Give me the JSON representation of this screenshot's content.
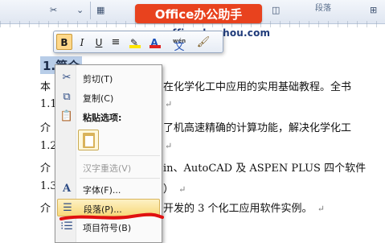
{
  "watermark": {
    "banner": "Office办公助手",
    "url": "www.officezhushou.com"
  },
  "ribbon": {
    "group_label": "段落",
    "icons": [
      "scissors-icon",
      "table-icon",
      "align-icon"
    ]
  },
  "document": {
    "heading": "1.简介",
    "lines": [
      {
        "left": "本",
        "right": "在化学化工中应用的实用基础教程。全书"
      },
      {
        "left": "1.1",
        "right": ""
      },
      {
        "left": "介",
        "right": "了机高速精确的计算功能，解决化学化工"
      },
      {
        "left": "1.2",
        "right": ""
      },
      {
        "left": "介",
        "right": "in、AutoCAD 及 ASPEN PLUS 四个软件"
      },
      {
        "left": "1.3",
        "right": "）"
      },
      {
        "left": "介",
        "right": "开发的 3 个化工应用软件实例。"
      }
    ],
    "para_mark": "↵"
  },
  "mini_toolbar": {
    "bold": "B",
    "italic": "I",
    "underline": "U",
    "align": "≡",
    "highlight": "✎",
    "font_color": "A",
    "phonetic_top": "wén",
    "phonetic_char": "文",
    "format_painter": "🖌"
  },
  "context_menu": {
    "items": [
      {
        "label": "剪切(T)",
        "icon": "scissors-icon",
        "enabled": true
      },
      {
        "label": "复制(C)",
        "icon": "copy-icon",
        "enabled": true
      },
      {
        "label": "粘贴选项:",
        "icon": "paste-icon",
        "enabled": true
      },
      {
        "label": "汉字重选(V)",
        "icon": "",
        "enabled": false
      },
      {
        "label": "字体(F)...",
        "icon": "font-icon",
        "enabled": true
      },
      {
        "label": "段落(P)...",
        "icon": "paragraph-icon",
        "enabled": true,
        "highlighted": true
      },
      {
        "label": "项目符号(B)",
        "icon": "bullets-icon",
        "enabled": true
      }
    ]
  },
  "colors": {
    "selection": "#b8cde8",
    "menu_highlight": "#f8d97b",
    "watermark_red": "#e8421e",
    "scribble_red": "#e01010"
  }
}
